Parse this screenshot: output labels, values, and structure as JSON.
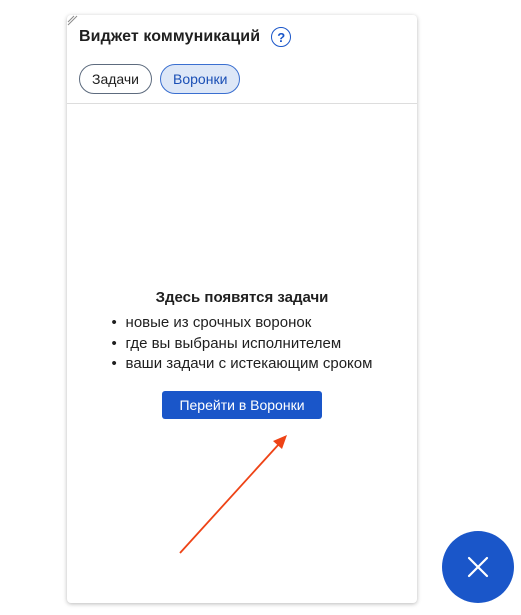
{
  "widget": {
    "title": "Виджет коммуникаций",
    "help_icon": "question-circle-icon",
    "tabs": [
      {
        "label": "Задачи",
        "active": false
      },
      {
        "label": "Воронки",
        "active": true
      }
    ],
    "empty_state": {
      "title": "Здесь появятся задачи",
      "items": [
        "новые из срочных воронок",
        "где вы выбраны исполнителем",
        "ваши задачи с истекающим сроком"
      ],
      "button_label": "Перейти в Воронки"
    }
  },
  "fab": {
    "icon": "close-icon"
  },
  "annotation": {
    "icon": "red-arrow-icon",
    "color": "#ee4316"
  },
  "colors": {
    "accent": "#1a56c9",
    "active_tab_bg": "#dde7f7",
    "text": "#1f1f1f"
  }
}
